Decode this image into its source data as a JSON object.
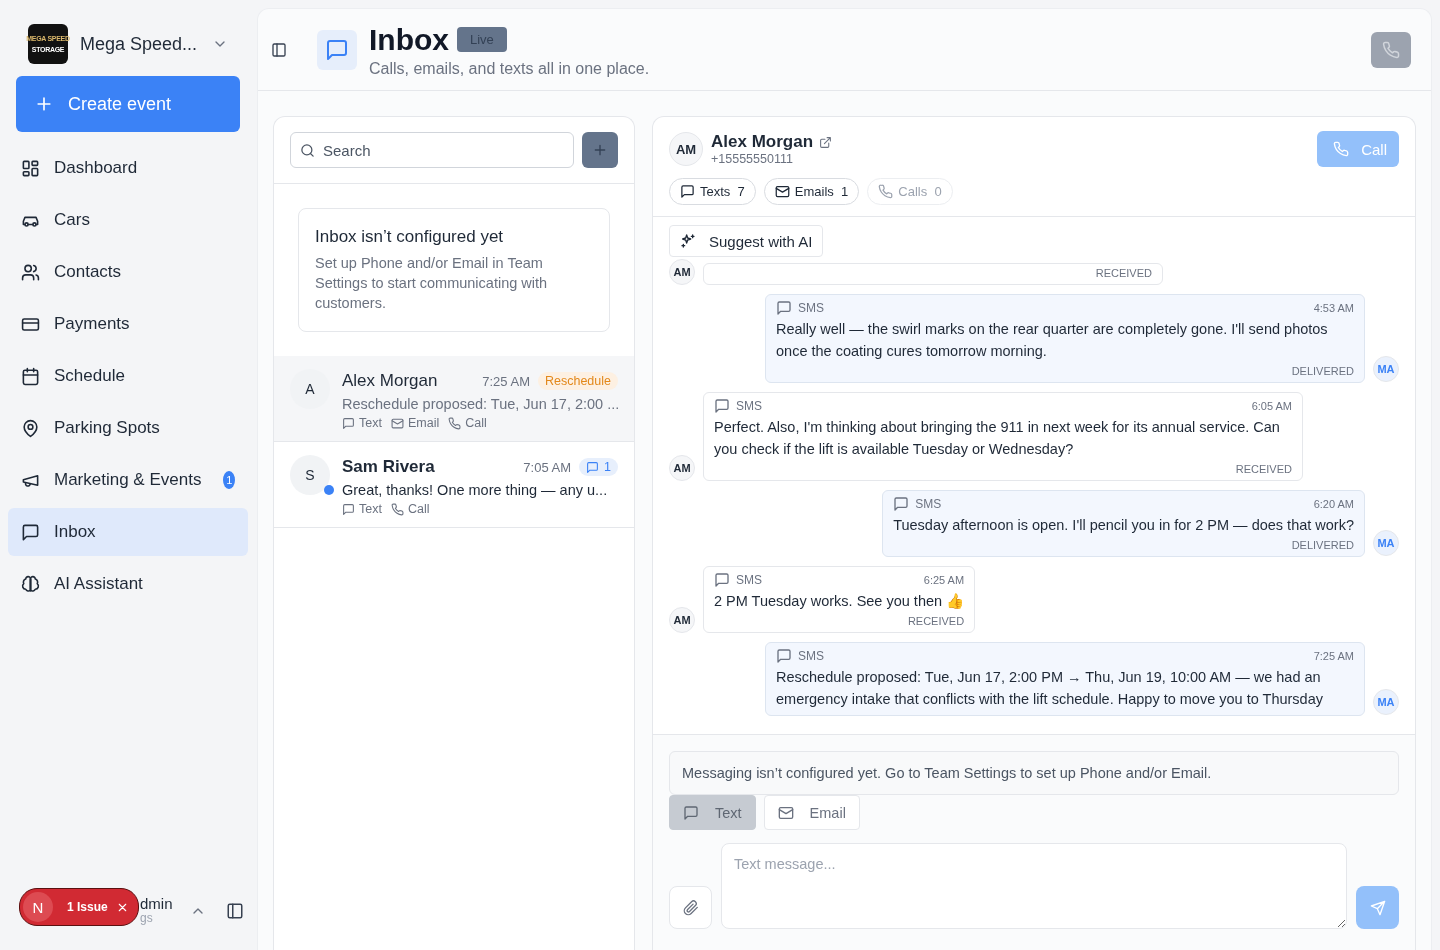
{
  "sidebar": {
    "workspace": {
      "name": "Mega Speed...",
      "logo_lines": [
        "MEGA SPEED",
        "STORAGE"
      ]
    },
    "create_button": "Create event",
    "items": [
      {
        "label": "Dashboard",
        "selected": false
      },
      {
        "label": "Cars",
        "selected": false
      },
      {
        "label": "Contacts",
        "selected": false
      },
      {
        "label": "Payments",
        "selected": false
      },
      {
        "label": "Schedule",
        "selected": false
      },
      {
        "label": "Parking Spots",
        "selected": false
      },
      {
        "label": "Marketing & Events",
        "selected": false,
        "badge": "1"
      },
      {
        "label": "Inbox",
        "selected": true
      },
      {
        "label": "AI Assistant",
        "selected": false
      }
    ],
    "user": {
      "name": "dmin",
      "subtitle": "gs"
    },
    "issue_badge": {
      "initial": "N",
      "label": "1 Issue"
    }
  },
  "header": {
    "title": "Inbox",
    "badge": "Live",
    "subtitle": "Calls, emails, and texts all in one place.",
    "call_button": {
      "disabled": true
    }
  },
  "conversations": {
    "search": {
      "placeholder": "Search"
    },
    "notice": {
      "title": "Inbox isn’t configured yet",
      "body": "Set up Phone and/or Email in Team Settings to start communicating with customers."
    },
    "items": [
      {
        "initial": "A",
        "name": "Alex Morgan",
        "time": "7:25 AM",
        "tag": "Reschedule",
        "preview": "Reschedule proposed: Tue, Jun 17, 2:00 ...",
        "channels": [
          {
            "kind": "text",
            "label": "Text"
          },
          {
            "kind": "email",
            "label": "Email"
          },
          {
            "kind": "call",
            "label": "Call"
          }
        ],
        "selected": true,
        "unread": false
      },
      {
        "initial": "S",
        "name": "Sam Rivera",
        "time": "7:05 AM",
        "count": "1",
        "preview": "Great, thanks! One more thing — any u...",
        "channels": [
          {
            "kind": "text",
            "label": "Text"
          },
          {
            "kind": "call",
            "label": "Call"
          }
        ],
        "selected": false,
        "unread": true
      }
    ]
  },
  "conversation": {
    "contact": {
      "initials": "AM",
      "name": "Alex Morgan",
      "phone": "+15555550111"
    },
    "call_button": {
      "label": "Call",
      "disabled": true
    },
    "tabs": [
      {
        "kind": "text",
        "label": "Texts",
        "count": "7",
        "disabled": false
      },
      {
        "kind": "email",
        "label": "Emails",
        "count": "1",
        "disabled": false
      },
      {
        "kind": "call",
        "label": "Calls",
        "count": "0",
        "disabled": true
      }
    ],
    "suggest_button": "Suggest with AI",
    "messages": [
      {
        "kind": "received",
        "initials": "AM",
        "status": "RECEIVED"
      },
      {
        "kind": "sent",
        "initials": "MA",
        "channel": "SMS",
        "time": "4:53 AM",
        "text": "Really well — the swirl marks on the rear quarter are completely gone. I'll send photos once the coating cures tomorrow morning.",
        "status": "DELIVERED"
      },
      {
        "kind": "received",
        "initials": "AM",
        "channel": "SMS",
        "time": "6:05 AM",
        "text": "Perfect. Also, I'm thinking about bringing the 911 in next week for its annual service. Can you check if the lift is available Tuesday or Wednesday?",
        "status": "RECEIVED"
      },
      {
        "kind": "sent",
        "initials": "MA",
        "channel": "SMS",
        "time": "6:20 AM",
        "text": "Tuesday afternoon is open. I'll pencil you in for 2 PM — does that work?",
        "status": "DELIVERED"
      },
      {
        "kind": "received",
        "initials": "AM",
        "channel": "SMS",
        "time": "6:25 AM",
        "text": "2 PM Tuesday works. See you then 👍",
        "status": "RECEIVED"
      },
      {
        "kind": "sent",
        "initials": "MA",
        "channel": "SMS",
        "time": "7:25 AM",
        "text": "Reschedule proposed: Tue, Jun 17, 2:00 PM → Thu, Jun 19, 10:00 AM — we had an emergency intake that conflicts with the lift schedule. Happy to move you to Thursday"
      }
    ],
    "composer": {
      "notice": "Messaging isn’t configured yet. Go to Team Settings to set up Phone and/or Email.",
      "modes": [
        {
          "kind": "text",
          "label": "Text",
          "selected": true
        },
        {
          "kind": "email",
          "label": "Email",
          "selected": false
        }
      ],
      "placeholder": "Text message..."
    }
  }
}
